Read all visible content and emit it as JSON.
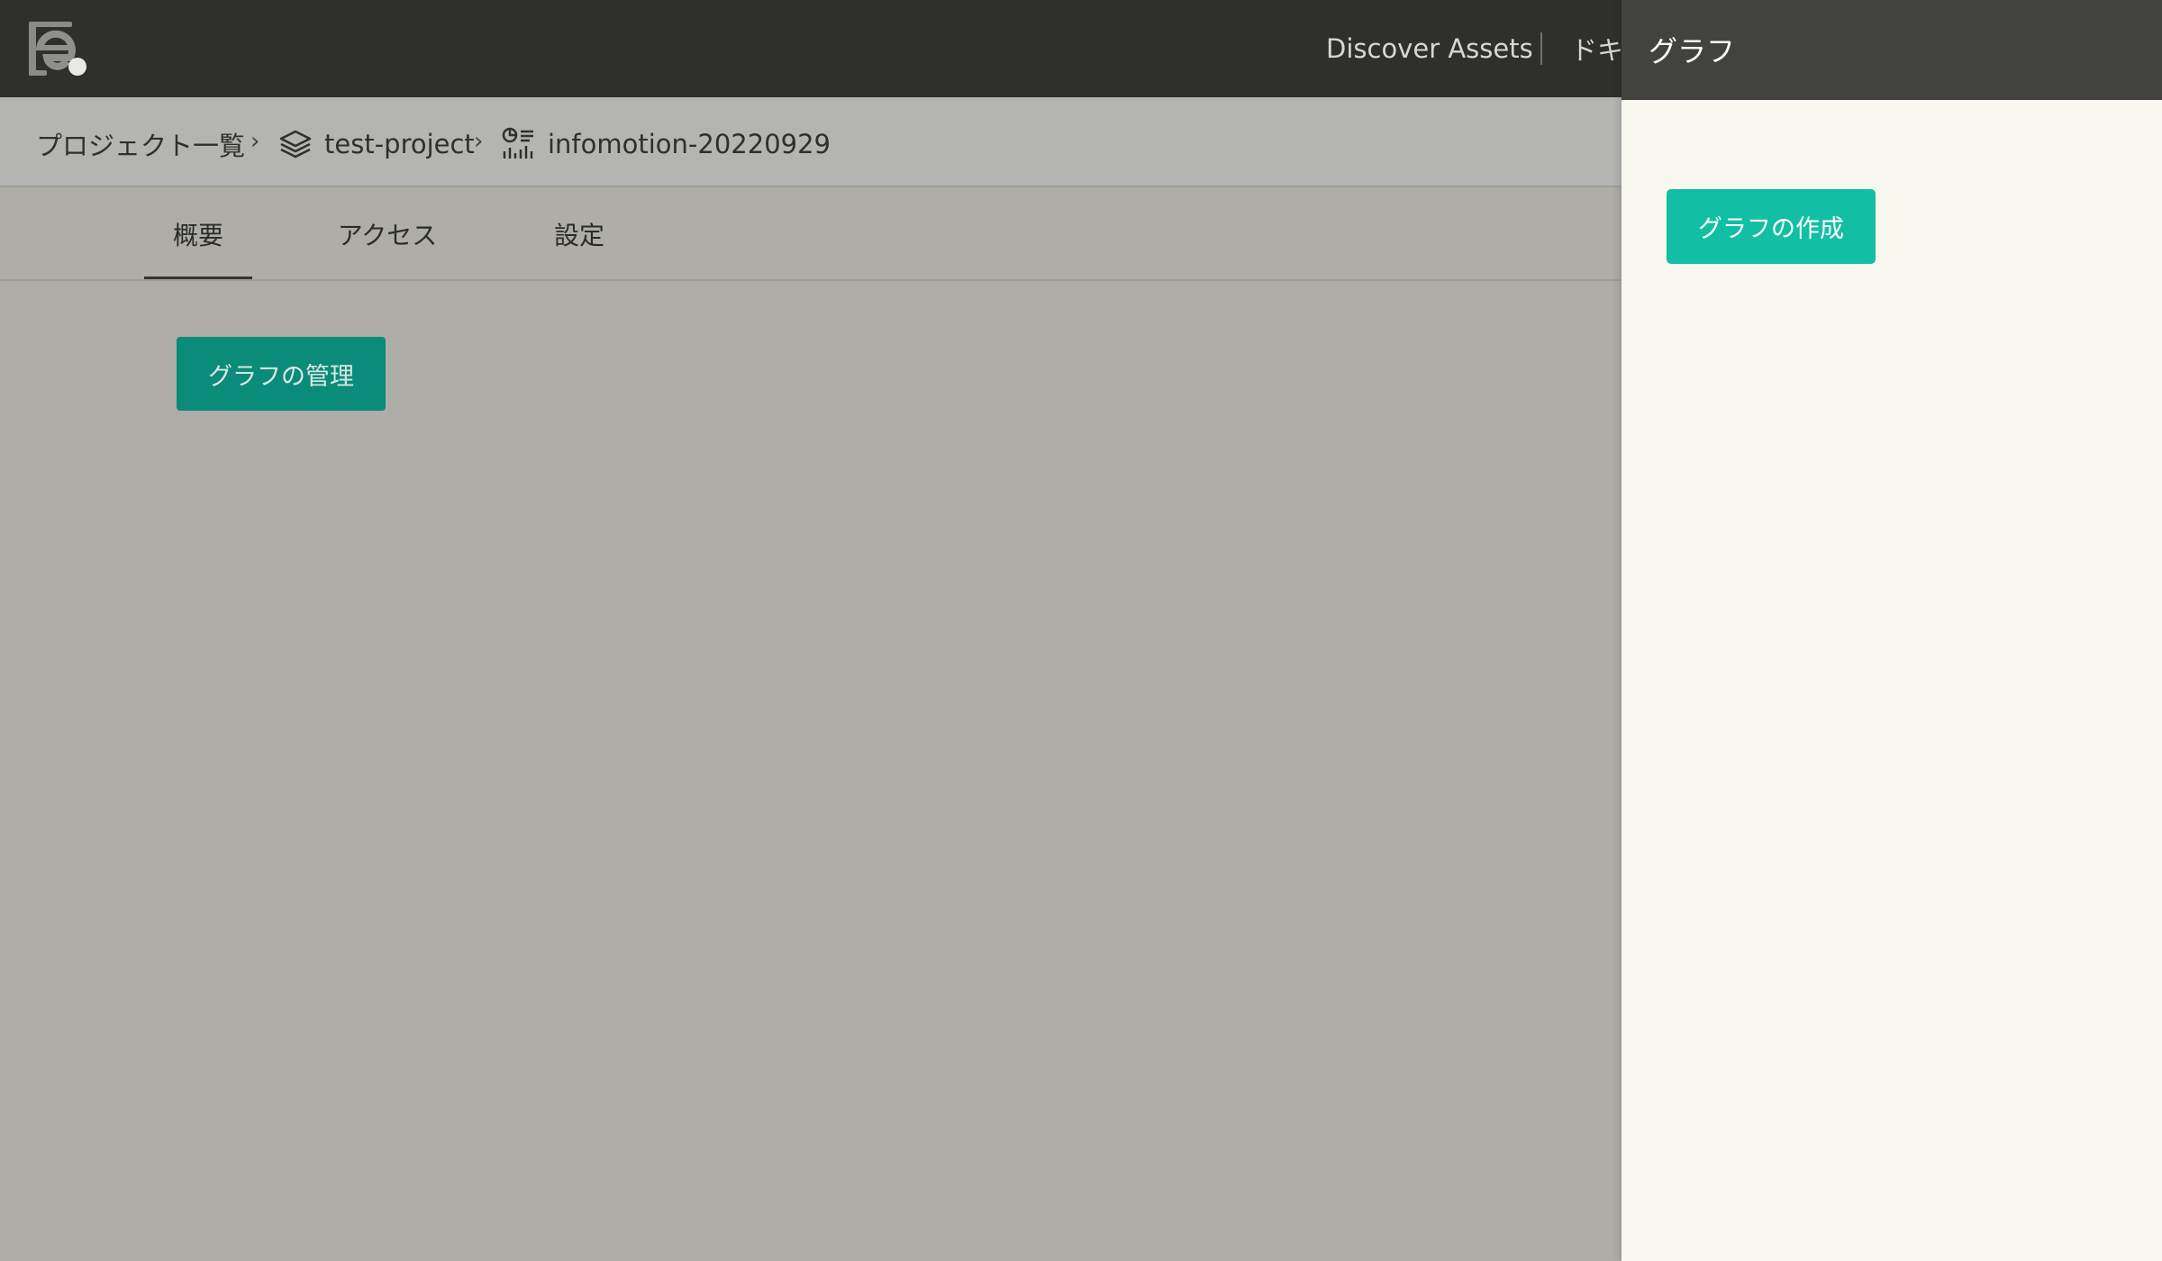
{
  "topbar": {
    "logo_icon": "e-logo-icon",
    "nav_discover": "Discover Assets",
    "nav_docs_partial": "ドキ"
  },
  "breadcrumb": {
    "projects": "プロジェクト一覧",
    "separator": "›",
    "project_icon": "layers-icon",
    "project": "test-project",
    "asset_icon": "chart-dashboard-icon",
    "asset": "infomotion-20220929"
  },
  "tabs": [
    {
      "label": "概要",
      "active": true
    },
    {
      "label": "アクセス",
      "active": false
    },
    {
      "label": "設定",
      "active": false
    }
  ],
  "main": {
    "manage_graph_button": "グラフの管理"
  },
  "drawer": {
    "title": "グラフ",
    "create_graph_button": "グラフの作成"
  },
  "colors": {
    "topbar_bg": "#2f2f2e",
    "overlay_page_bg": "#aeada8",
    "primary_button": "#12bfa4",
    "drawer_bg": "#f8f8f1",
    "drawer_header_bg": "#424240"
  }
}
